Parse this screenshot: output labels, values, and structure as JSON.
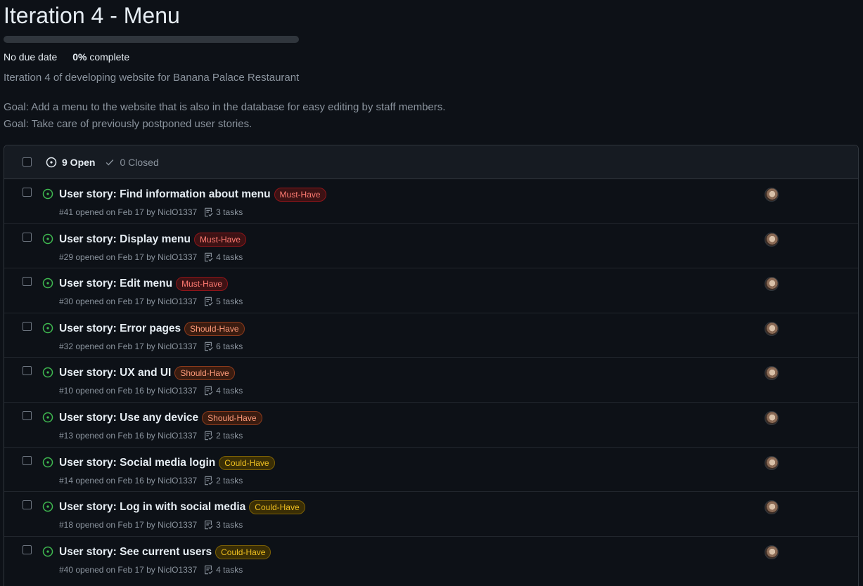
{
  "milestone": {
    "title": "Iteration 4 - Menu",
    "due": "No due date",
    "percent": "0%",
    "percent_label": "complete",
    "progress_fraction": 0,
    "description": "Iteration 4 of developing website for Banana Palace Restaurant",
    "goals": [
      "Goal: Add a menu to the website that is also in the database for easy editing by staff members.",
      "Goal: Take care of previously postponed user stories."
    ]
  },
  "states": {
    "open": "9 Open",
    "closed": "0 Closed"
  },
  "label_colors": {
    "must": "#ff7b72",
    "should": "#ff9b7a",
    "could": "#f0c020",
    "open_icon": "#3fb950"
  },
  "issues": [
    {
      "title": "User story: Find information about menu",
      "label": "Must-Have",
      "label_type": "must",
      "number": "#41",
      "opened": "opened on Feb 17 by NiclO1337",
      "tasks": "3 tasks"
    },
    {
      "title": "User story: Display menu",
      "label": "Must-Have",
      "label_type": "must",
      "number": "#29",
      "opened": "opened on Feb 17 by NiclO1337",
      "tasks": "4 tasks"
    },
    {
      "title": "User story: Edit menu",
      "label": "Must-Have",
      "label_type": "must",
      "number": "#30",
      "opened": "opened on Feb 17 by NiclO1337",
      "tasks": "5 tasks"
    },
    {
      "title": "User story: Error pages",
      "label": "Should-Have",
      "label_type": "should",
      "number": "#32",
      "opened": "opened on Feb 17 by NiclO1337",
      "tasks": "6 tasks"
    },
    {
      "title": "User story: UX and UI",
      "label": "Should-Have",
      "label_type": "should",
      "number": "#10",
      "opened": "opened on Feb 16 by NiclO1337",
      "tasks": "4 tasks"
    },
    {
      "title": "User story: Use any device",
      "label": "Should-Have",
      "label_type": "should",
      "number": "#13",
      "opened": "opened on Feb 16 by NiclO1337",
      "tasks": "2 tasks"
    },
    {
      "title": "User story: Social media login",
      "label": "Could-Have",
      "label_type": "could",
      "number": "#14",
      "opened": "opened on Feb 16 by NiclO1337",
      "tasks": "2 tasks"
    },
    {
      "title": "User story: Log in with social media",
      "label": "Could-Have",
      "label_type": "could",
      "number": "#18",
      "opened": "opened on Feb 17 by NiclO1337",
      "tasks": "3 tasks"
    },
    {
      "title": "User story: See current users",
      "label": "Could-Have",
      "label_type": "could",
      "number": "#40",
      "opened": "opened on Feb 17 by NiclO1337",
      "tasks": "4 tasks"
    }
  ]
}
